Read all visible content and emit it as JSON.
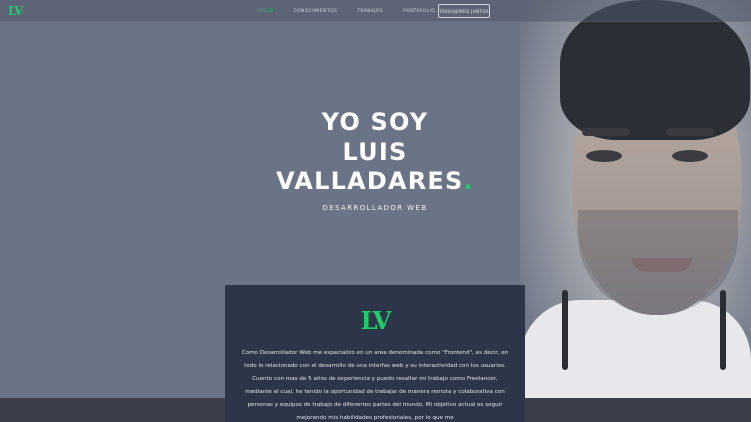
{
  "brand": {
    "logo": "LV",
    "accent": "#1fcc6b"
  },
  "nav": {
    "links": [
      {
        "label": "INICIO",
        "active": true
      },
      {
        "label": "CONOCIMIENTOS",
        "active": false
      },
      {
        "label": "TRABAJOS",
        "active": false
      },
      {
        "label": "PORTAFOLIO",
        "active": false
      }
    ],
    "cta": "TRABAJEMOS JUNTOS"
  },
  "hero": {
    "line1": "YO SOY",
    "line2": "LUIS",
    "line3": "VALLADARES",
    "dot": ".",
    "subtitle": "DESARROLLADOR WEB"
  },
  "about": {
    "logo": "LV",
    "text": "Como Desarrollador Web me especializo en un area denominada como \"Frontend\", es decir, en todo lo relacionado con el desarrollo de una interfas web y su interactividad con los usuarios. Cuento con mas de 5 años de experiencia y puedo resaltar mi trabajo como Freelancer, mediante el cual, he tenido la oportunidad de trabajar de manera remota y colaborativa con personas y equipos de trabajo de diferentes partes del mundo. Mi objetivo actual es seguir mejorando mis habilidades profesionales, por lo que me"
  }
}
